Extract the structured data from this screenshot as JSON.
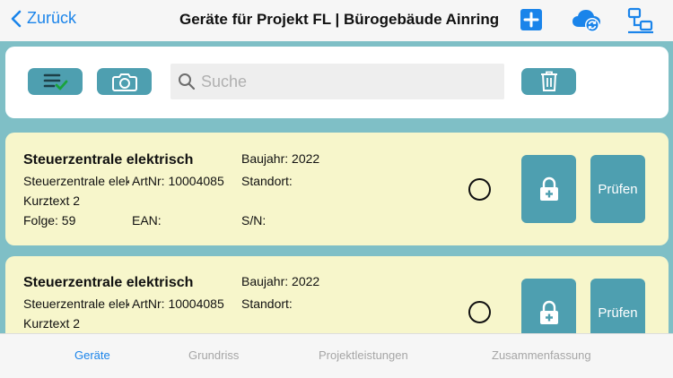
{
  "nav": {
    "back_label": "Zurück",
    "title": "Geräte für Projekt FL | Bürogebäude Ainring",
    "icons": [
      "plus-square-icon",
      "cloud-sync-icon",
      "network-icon"
    ]
  },
  "toolbar": {
    "icons": [
      "checklist-icon",
      "camera-icon",
      "trash-icon"
    ],
    "search_placeholder": "Suche",
    "search_value": ""
  },
  "devices": [
    {
      "name": "Steuerzentrale elektrisch",
      "desc": "Steuerzentrale elektrisch",
      "artnr": "ArtNr: 10004085",
      "kurztext": "Kurztext 2",
      "folge": "Folge: 59",
      "ean": "EAN:",
      "baujahr": "Baujahr: 2022",
      "standort": "Standort:",
      "sn": "S/N:",
      "pruefen_label": "Prüfen"
    },
    {
      "name": "Steuerzentrale elektrisch",
      "desc": "Steuerzentrale elektrisch",
      "artnr": "ArtNr: 10004085",
      "kurztext": "Kurztext 2",
      "baujahr": "Baujahr: 2022",
      "standort": "Standort:",
      "pruefen_label": "Prüfen"
    }
  ],
  "tabs": [
    {
      "label": "Geräte",
      "active": true
    },
    {
      "label": "Grundriss",
      "active": false
    },
    {
      "label": "Projektleistungen",
      "active": false
    },
    {
      "label": "Zusammenfassung",
      "active": false
    }
  ],
  "colors": {
    "accent": "#1a84ea",
    "button": "#4e9fb0",
    "background": "#7fbfc6",
    "card": "#f7f6cb"
  }
}
